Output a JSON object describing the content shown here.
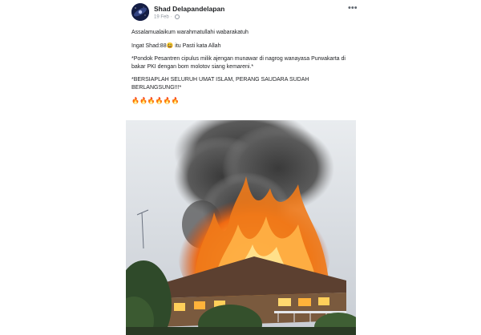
{
  "post": {
    "author": "Shad Delapandelapan",
    "date": "19 Feb",
    "separator": "·",
    "lines": [
      "Assalamualaikum warahmatullahi wabarakatuh",
      "Ingat Shad:88",
      "itu Pasti kata Allah",
      "*Pondok Pesantren cipulus milik ajengan munawar di nagrog wanayasa Purwakarta di bakar PKI dengan bom molotov siang kemareni.*",
      "*BERSIAPLAH SELURUH UMAT ISLAM, PERANG SAUDARA SUDAH BERLANGSUNG!!!*"
    ],
    "inline_emoji": "😃",
    "fire_emojis": "🔥🔥🔥🔥🔥🔥"
  },
  "icons": {
    "avatar": "avatar-galaxy",
    "globe": "globe-icon",
    "more": "more-options-icon"
  },
  "colors": {
    "author": "#1c1e21",
    "meta": "#8d949e",
    "fire": "#f07a1a"
  }
}
